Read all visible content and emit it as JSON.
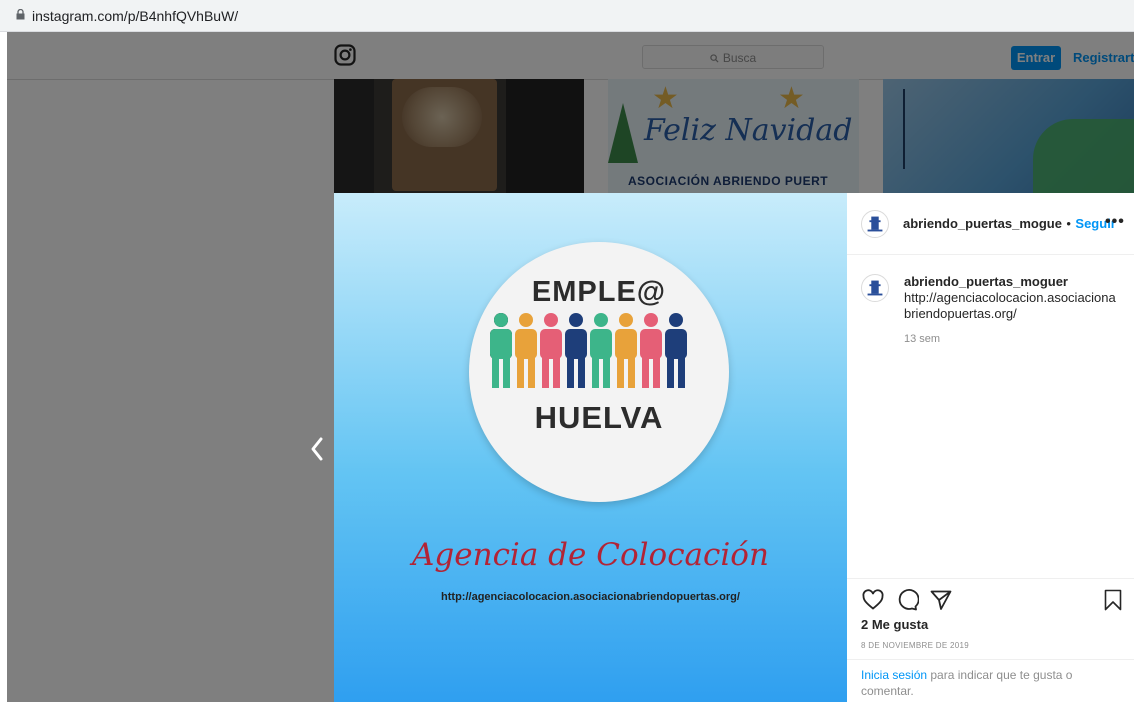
{
  "browser": {
    "url": "instagram.com/p/B4nhfQVhBuW/"
  },
  "header": {
    "search_placeholder": "Busca",
    "login_button": "Entrar",
    "register_link": "Registrarte"
  },
  "grid": {
    "thumb2_title": "Feliz Navidad",
    "thumb2_subtitle": "ASOCIACIÓN ABRIENDO PUERT"
  },
  "post": {
    "media": {
      "top_word": "EMPLE@",
      "bottom_word": "HUELVA",
      "headline": "Agencia de Colocación",
      "url_text": "http://agenciacolocacion.asociacionabriendopuertas.org/"
    },
    "header": {
      "username": "abriendo_puertas_mogue",
      "separator": "•",
      "follow_label": "Seguir",
      "more_label": "•••"
    },
    "caption": {
      "username": "abriendo_puertas_moguer",
      "text": "http://agenciacolocacion.asociacionabriendopuertas.org/"
    },
    "time_ago": "13 sem",
    "likes": "2 Me gusta",
    "date": "8 DE NOVIEMBRE DE 2019",
    "login_prompt": {
      "link": "Inicia sesión",
      "rest": " para indicar que te gusta o comentar."
    }
  },
  "colors": {
    "accent": "#0095f6",
    "headline": "#b22436"
  },
  "icons": [
    "lock-icon",
    "instagram-logo-icon",
    "search-icon",
    "heart-icon",
    "comment-icon",
    "share-icon",
    "bookmark-icon",
    "chevron-left-icon"
  ]
}
